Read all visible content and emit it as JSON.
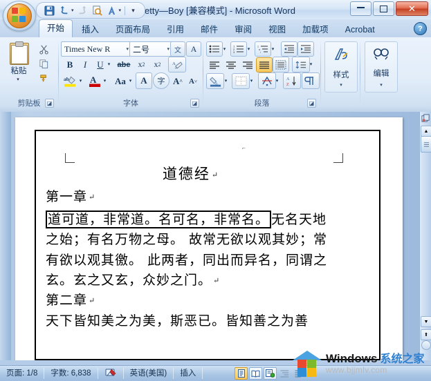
{
  "window": {
    "title": "Pretty—Boy [兼容模式] - Microsoft Word",
    "minimize_label": "—",
    "restore_label": "❐",
    "close_label": "✕"
  },
  "quick_access": {
    "office_button": "office-orb",
    "items": [
      {
        "name": "save",
        "glyph": "💾"
      },
      {
        "name": "undo",
        "glyph": "↰"
      },
      {
        "name": "redo",
        "glyph": "↻"
      },
      {
        "name": "print-preview",
        "glyph": "🔍"
      },
      {
        "name": "format-painter-quick",
        "glyph": "A"
      }
    ],
    "customize_glyph": "▾"
  },
  "ribbon": {
    "tabs": [
      {
        "label": "开始",
        "active": true
      },
      {
        "label": "插入",
        "active": false
      },
      {
        "label": "页面布局",
        "active": false
      },
      {
        "label": "引用",
        "active": false
      },
      {
        "label": "邮件",
        "active": false
      },
      {
        "label": "审阅",
        "active": false
      },
      {
        "label": "视图",
        "active": false
      },
      {
        "label": "加载项",
        "active": false
      },
      {
        "label": "Acrobat",
        "active": false
      }
    ],
    "help_label": "?",
    "groups": [
      {
        "name": "clipboard",
        "label": "剪贴板",
        "paste_label": "粘贴",
        "paste_caret": "▾",
        "buttons": [
          {
            "name": "cut",
            "glyph": "✂"
          },
          {
            "name": "copy",
            "glyph": "❐"
          },
          {
            "name": "format-painter",
            "glyph": "🖌"
          }
        ]
      },
      {
        "name": "font",
        "label": "字体",
        "font_name": "Times New R",
        "font_size": "二号",
        "buttons": [
          {
            "name": "phonetic-guide",
            "glyph": "文"
          },
          {
            "name": "character-border",
            "glyph": "A"
          },
          {
            "name": "bold",
            "glyph": "B"
          },
          {
            "name": "italic",
            "glyph": "I"
          },
          {
            "name": "underline",
            "glyph": "U"
          },
          {
            "name": "strikethrough",
            "glyph": "abe"
          },
          {
            "name": "subscript",
            "glyph": "x₂"
          },
          {
            "name": "superscript",
            "glyph": "x²"
          },
          {
            "name": "clear-formatting",
            "glyph": "A⃠"
          },
          {
            "name": "text-highlight",
            "glyph": "ab"
          },
          {
            "name": "font-color",
            "glyph": "A"
          },
          {
            "name": "change-case",
            "glyph": "Aa"
          },
          {
            "name": "character-shading",
            "glyph": "A"
          },
          {
            "name": "enclose-characters",
            "glyph": "字"
          },
          {
            "name": "grow-font",
            "glyph": "A˄"
          },
          {
            "name": "shrink-font",
            "glyph": "A˅"
          }
        ]
      },
      {
        "name": "paragraph",
        "label": "段落",
        "buttons": [
          {
            "name": "bullets",
            "glyph": "☰"
          },
          {
            "name": "numbering",
            "glyph": "☰"
          },
          {
            "name": "multilevel-list",
            "glyph": "☰"
          },
          {
            "name": "decrease-indent",
            "glyph": "⇤"
          },
          {
            "name": "increase-indent",
            "glyph": "⇥"
          },
          {
            "name": "align-left",
            "glyph": "≡"
          },
          {
            "name": "align-center",
            "glyph": "≡"
          },
          {
            "name": "align-right",
            "glyph": "≡"
          },
          {
            "name": "justify",
            "glyph": "≡"
          },
          {
            "name": "distributed",
            "glyph": "≣"
          },
          {
            "name": "line-spacing",
            "glyph": "↕≡"
          },
          {
            "name": "shading",
            "glyph": "◩"
          },
          {
            "name": "borders",
            "glyph": "▦"
          },
          {
            "name": "asian-layout",
            "glyph": "⚘"
          },
          {
            "name": "sort",
            "glyph": "A↓"
          },
          {
            "name": "show-formatting-marks",
            "glyph": "¶"
          }
        ]
      },
      {
        "name": "styles",
        "label": "样式",
        "button_label": "样式",
        "glyph": "A",
        "caret": "▾"
      },
      {
        "name": "editing",
        "label": "编辑",
        "button_label": "编辑",
        "glyph": "🔍",
        "caret": "▾"
      }
    ]
  },
  "document": {
    "title": "道德经",
    "header_mark": "⌐",
    "paragraphs": [
      {
        "name": "chapter-1-heading",
        "text": "第一章",
        "mark": "↵"
      },
      {
        "name": "chapter-1-selected",
        "text": "道可道，非常道。名可名，非常名。",
        "selected": true
      },
      {
        "name": "chapter-1-body",
        "text": "无名天地之始；有名万物之母。 故常无欲以观其妙；常有欲以观其徼。 此两者，同出而异名，同谓之玄。玄之又玄，众妙之门。",
        "mark": "↵"
      },
      {
        "name": "chapter-2-heading",
        "text": "第二章",
        "mark": "↵"
      },
      {
        "name": "chapter-2-body",
        "text": "天下皆知美之为美，斯恶已。皆知善之为善"
      }
    ],
    "pilcrow": "↵"
  },
  "scrollbar": {
    "up_arrow": "▲",
    "down_arrow": "▼",
    "previous_page": "⬆",
    "next_page": "⬇",
    "select_browse_object": "○",
    "object_browse_icon": "⧉",
    "thumb": "≡"
  },
  "status_bar": {
    "page": "页面: 1/8",
    "word_count": "字数: 6,838",
    "proofing_icon": "proofing-errors-icon",
    "language": "英语(美国)",
    "insert_mode": "插入",
    "view_buttons": [
      {
        "name": "print-layout-view",
        "glyph": "▤",
        "active": true
      },
      {
        "name": "full-screen-reading-view",
        "glyph": "📖",
        "active": false
      },
      {
        "name": "web-layout-view",
        "glyph": "▤",
        "active": false
      },
      {
        "name": "outline-view",
        "glyph": "☰",
        "active": false
      },
      {
        "name": "draft-view",
        "glyph": "≡",
        "active": false
      }
    ]
  },
  "watermark": {
    "brand_en": "Windows",
    "brand_cn": "系统之家",
    "url": "www.bjjmlv.com"
  },
  "colors": {
    "accent_blue": "#2f7fd0",
    "title_text": "#15335e",
    "ribbon_bg": "#e2edf9",
    "close_red": "#c33f21",
    "highlight_orange": "#f8c85e",
    "logo_red": "#e8492f",
    "logo_green": "#7cba2c",
    "logo_blue": "#2f8fd6",
    "logo_yellow": "#f5b912"
  }
}
